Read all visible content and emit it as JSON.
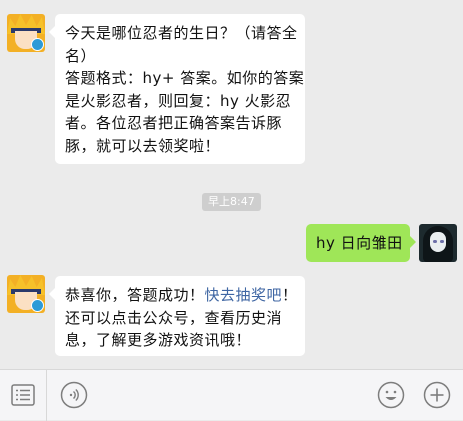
{
  "messages": [
    {
      "side": "left",
      "lines": [
        "今天是哪位忍者的生日？（请答全",
        "名）",
        "答题格式：hy+ 答案。如你的答案",
        "是火影忍者，则回复：hy 火影忍",
        "者。各位忍者把正确答案告诉豚",
        "豚，就可以去领奖啦！"
      ]
    },
    {
      "side": "right",
      "text": "hy 日向雏田"
    },
    {
      "side": "left",
      "line1_prefix": "恭喜你，答题成功！",
      "line1_link": "快去抽奖吧",
      "line1_suffix": "！",
      "lines_rest": [
        "还可以点击公众号，查看历史消",
        "息，了解更多游戏资讯哦！"
      ]
    }
  ],
  "timestamp": "早上8:47",
  "icons": {
    "menu": "menu-list-icon",
    "voice": "voice-icon",
    "emoji": "emoji-icon",
    "add": "plus-icon"
  },
  "colors": {
    "sent_bubble": "#9fe658",
    "received_bubble": "#ffffff",
    "link": "#3f66a3",
    "background": "#ebebeb"
  }
}
